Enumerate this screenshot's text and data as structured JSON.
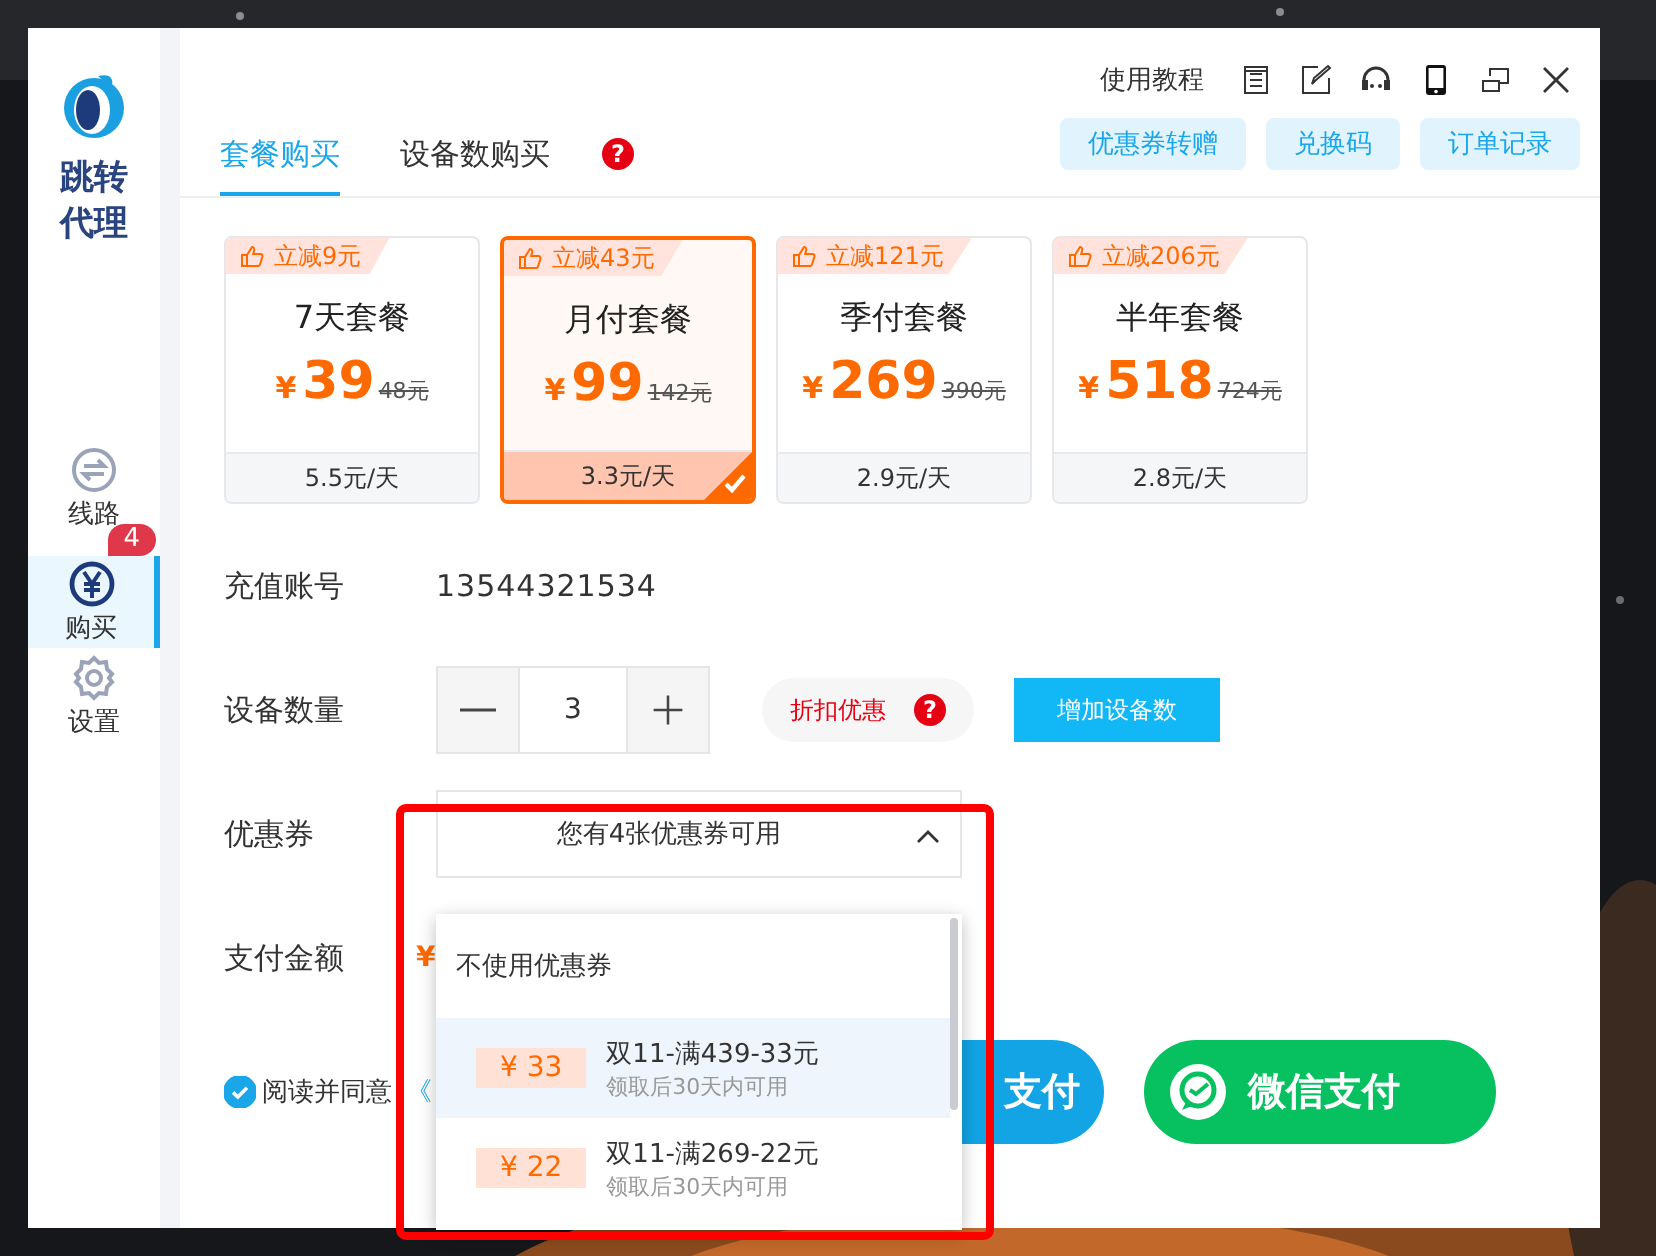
{
  "sidebar": {
    "logo_text": "跳转代理",
    "items": [
      {
        "label": "线路",
        "selected": false
      },
      {
        "label": "购买",
        "selected": true,
        "badge": "4"
      },
      {
        "label": "设置",
        "selected": false
      }
    ]
  },
  "titlebar": {
    "tutorial": "使用教程"
  },
  "tabs": [
    {
      "label": "套餐购买",
      "selected": true
    },
    {
      "label": "设备数购买",
      "selected": false
    }
  ],
  "tab_help": "?",
  "actions": [
    "优惠券转赠",
    "兑换码",
    "订单记录"
  ],
  "plans": [
    {
      "tag": "立减9元",
      "name": "7天套餐",
      "currency": "¥",
      "price": "39",
      "original": "48元",
      "per_day": "5.5元/天",
      "selected": false
    },
    {
      "tag": "立减43元",
      "name": "月付套餐",
      "currency": "¥",
      "price": "99",
      "original": "142元",
      "per_day": "3.3元/天",
      "selected": true
    },
    {
      "tag": "立减121元",
      "name": "季付套餐",
      "currency": "¥",
      "price": "269",
      "original": "390元",
      "per_day": "2.9元/天",
      "selected": false
    },
    {
      "tag": "立减206元",
      "name": "半年套餐",
      "currency": "¥",
      "price": "518",
      "original": "724元",
      "per_day": "2.8元/天",
      "selected": false
    }
  ],
  "account": {
    "label": "充值账号",
    "value": "13544321534"
  },
  "devices": {
    "label": "设备数量",
    "value": "3",
    "discount": "折扣优惠",
    "discount_help": "?",
    "add_button": "增加设备数"
  },
  "coupon": {
    "label": "优惠券",
    "value": "您有4张优惠券可用",
    "expanded": true,
    "options": [
      {
        "kind": "none",
        "title": "不使用优惠券",
        "selected": false
      },
      {
        "kind": "coupon",
        "amount": "¥ 33",
        "title": "双11-满439-33元",
        "note": "领取后30天内可用",
        "selected": true
      },
      {
        "kind": "coupon",
        "amount": "¥ 22",
        "title": "双11-满269-22元",
        "note": "领取后30天内可用",
        "selected": false
      }
    ]
  },
  "payment": {
    "label": "支付金额",
    "currency": "¥",
    "buttons": [
      {
        "kind": "alipay",
        "label": "支付"
      },
      {
        "kind": "wechat",
        "label": "微信支付"
      }
    ]
  },
  "agreement": {
    "checked": true,
    "text": "阅读并同意",
    "link": "《"
  }
}
